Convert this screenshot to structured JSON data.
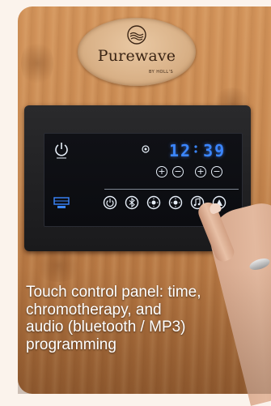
{
  "plaque": {
    "brand": "Purewave",
    "sub": "BY HOLL'S"
  },
  "panel": {
    "time_display": "12 39",
    "bottom_buttons": [
      {
        "icon": "power-icon"
      },
      {
        "icon": "bluetooth-icon"
      },
      {
        "icon": "light-icon"
      },
      {
        "icon": "light-icon"
      },
      {
        "icon": "music-icon"
      },
      {
        "icon": "sauna-icon"
      }
    ]
  },
  "caption": {
    "text": "Touch control panel: time,\nchromotherapy, and\naudio (bluetooth / MP3)\nprogramming"
  },
  "colors": {
    "display": "#3b86ff",
    "wood": "#c98a52",
    "panel": "#0b0c10"
  }
}
